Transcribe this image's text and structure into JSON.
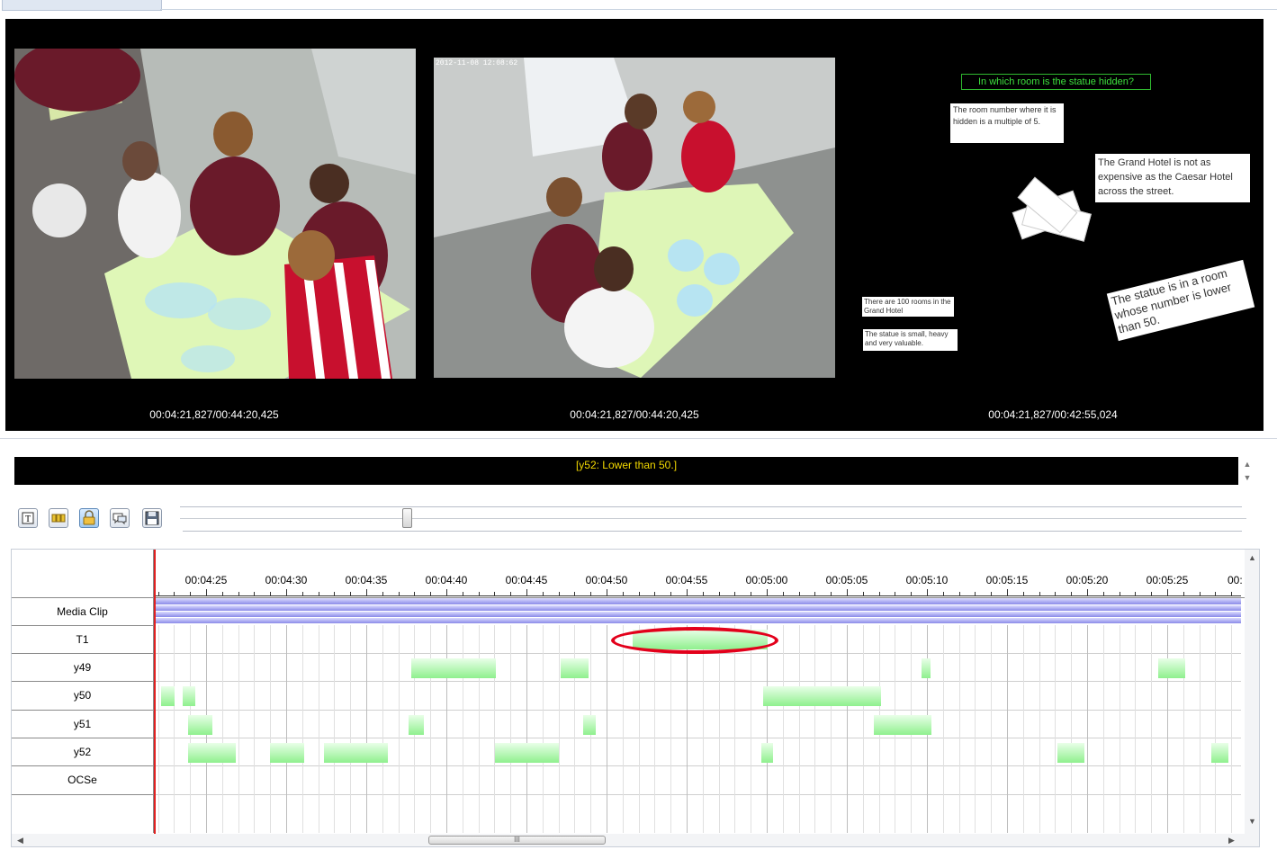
{
  "viewer": {
    "video1_time": "00:04:21,827/00:44:20,425",
    "video2_time": "00:04:21,827/00:44:20,425",
    "video3_time": "00:04:21,827/00:42:55,024",
    "video2_timestamp_overlay": "2012-11-08 12:08:62",
    "screen_capture": {
      "question": "In which room is the statue hidden?",
      "card1": "The room number where it is hidden is a multiple of 5.",
      "card2": "The Grand Hotel is not as expensive as the Caesar Hotel across the street.",
      "card3": "The statue is in a room whose number is lower than 50.",
      "card4": "There are 100 rooms in the Grand Hotel",
      "card5": "The statue is small, heavy and very valuable."
    }
  },
  "subtitle": {
    "text": "[y52: Lower than 50.]"
  },
  "toolbar": {
    "buttons": [
      "text-mode-icon",
      "bulk-mode-icon",
      "lock-icon",
      "comment-icon",
      "save-icon"
    ]
  },
  "timeline": {
    "ticks": [
      "00:04:25",
      "00:04:30",
      "00:04:35",
      "00:04:40",
      "00:04:45",
      "00:04:50",
      "00:04:55",
      "00:05:00",
      "00:05:05",
      "00:05:10",
      "00:05:15",
      "00:05:20",
      "00:05:25",
      "00:"
    ],
    "tiers": [
      "Media Clip",
      "T1",
      "y49",
      "y50",
      "y51",
      "y52",
      "OCSe"
    ],
    "scroll_thumb_label": "III",
    "accent_color": "#e02020",
    "annotation_color": "#8ff08e"
  }
}
